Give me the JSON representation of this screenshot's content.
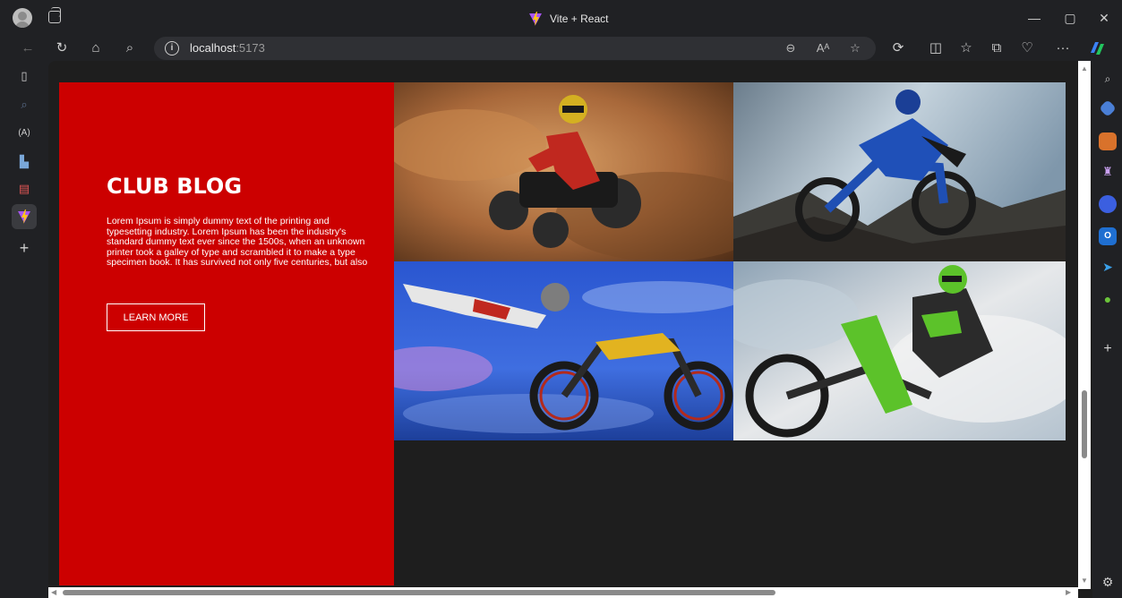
{
  "browser": {
    "tab_title": "Vite + React",
    "url_host": "localhost",
    "url_port": ":5173",
    "window_controls": {
      "minimize": "—",
      "maximize": "▢",
      "close": "✕"
    },
    "toolbar": {
      "back": "←",
      "reload": "↻",
      "home": "⌂",
      "search": "⌕",
      "more": "···"
    }
  },
  "hero": {
    "title": "CLUB BLOG",
    "body": "Lorem Ipsum is simply dummy text of the printing and typesetting industry. Lorem Ipsum has been the industry's standard dummy text ever since the 1500s, when an unknown printer took a galley of type and scrambled it to make a type specimen book. It has survived not only five centuries, but also",
    "button_label": "LEARN MORE",
    "background_color": "#cc0000"
  },
  "gallery": [
    {
      "subject": "atv-rider-desert"
    },
    {
      "subject": "blue-motocross-rider"
    },
    {
      "subject": "freestyle-motocross-jump"
    },
    {
      "subject": "green-motocross-rider"
    }
  ],
  "colors": {
    "browser_chrome": "#202124",
    "page_background": "#1e1e1e",
    "accent_red": "#cc0000"
  }
}
